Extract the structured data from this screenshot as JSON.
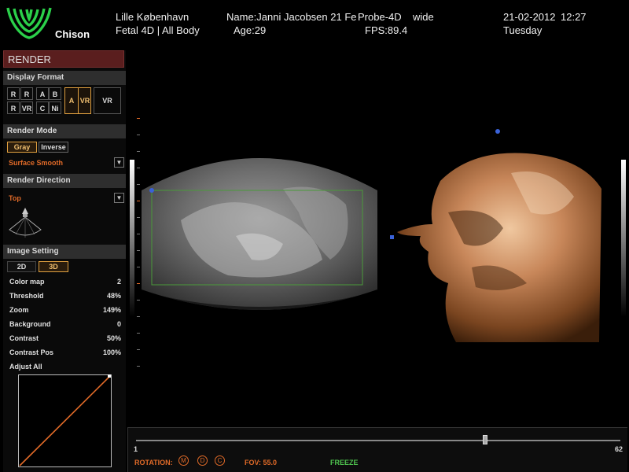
{
  "header": {
    "brand": "Chison",
    "hospital": "Lille København",
    "exam": "Fetal 4D | All Body",
    "patient_name": "Name:Janni Jacobsen 21 Fe",
    "age": "Age:29",
    "probe": "Probe-4D",
    "probe_mode": "wide",
    "fps": "FPS:89.4",
    "date": "21-02-2012",
    "time": "12:27",
    "weekday": "Tuesday"
  },
  "panel": {
    "title": "RENDER",
    "display_format": {
      "label": "Display Format",
      "row1": [
        "R",
        "R",
        "A",
        "B"
      ],
      "row2": [
        "R",
        "VR",
        "C",
        "Ni"
      ],
      "selected": [
        "A",
        "VR"
      ],
      "vr": "VR"
    },
    "render_mode": {
      "label": "Render Mode",
      "gray": "Gray",
      "inverse": "Inverse",
      "surface": "Surface Smooth"
    },
    "render_direction": {
      "label": "Render Direction",
      "value": "Top"
    },
    "image_setting": {
      "label": "Image Setting",
      "btn_2d": "2D",
      "btn_3d": "3D",
      "rows": [
        {
          "label": "Color map",
          "value": "2"
        },
        {
          "label": "Threshold",
          "value": "48%"
        },
        {
          "label": "Zoom",
          "value": "149%"
        },
        {
          "label": "Background",
          "value": "0"
        },
        {
          "label": "Contrast",
          "value": "50%"
        },
        {
          "label": "Contrast Pos",
          "value": "100%"
        }
      ],
      "adjust_all": "Adjust All"
    }
  },
  "bottom": {
    "slider_min": "1",
    "slider_max": "62",
    "slider_value_fraction": 0.72,
    "rotation_label": "ROTATION:",
    "rot_icons": [
      "M",
      "D",
      "C"
    ],
    "fov": "FOV: 55.0",
    "freeze": "FREEZE"
  },
  "colors": {
    "accent_orange": "#e06a28",
    "freeze_green": "#4ec24e",
    "roi_green": "#4a9a3a",
    "marker_blue": "#3a62d8",
    "render_header": "#5a1e1e"
  }
}
